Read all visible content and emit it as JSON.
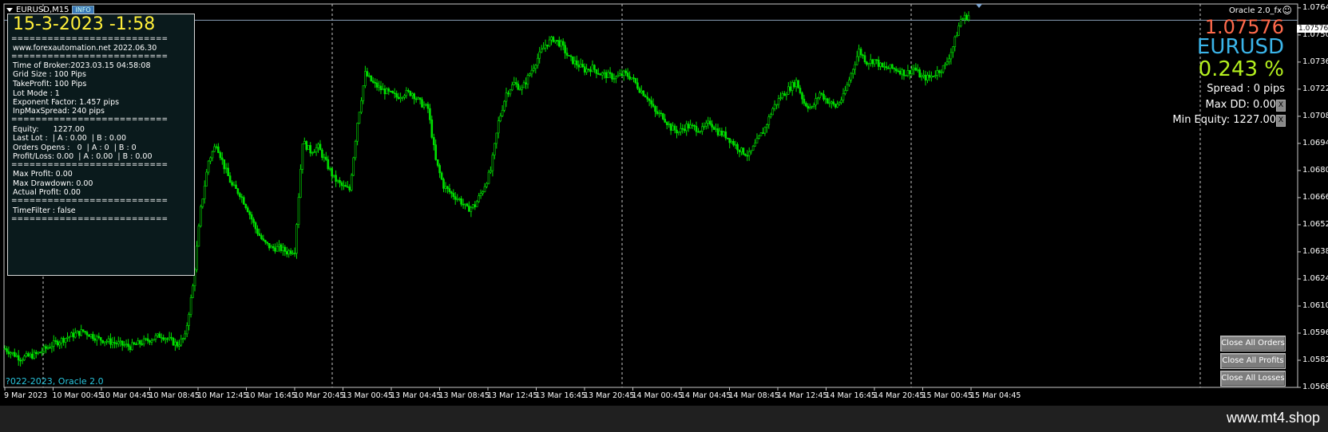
{
  "window": {
    "title": "EURUSD,M15",
    "info_badge": "INFO"
  },
  "ea": {
    "name": "Oracle 2.0_fx",
    "smile": "☺"
  },
  "panel": {
    "clock": "15-3-2023 -1:58",
    "separator": "==========================",
    "website": "www.forexautomation.net 2022.06.30",
    "time_of_broker": "Time of Broker:2023.03.15 04:58:08",
    "grid_size": "Grid Size : 100 Pips",
    "take_profit": "TakeProfit: 100 Pips",
    "lot_mode": "Lot Mode : 1",
    "exponent_factor": "Exponent Factor: 1.457 pips",
    "inp_max_spread": "InpMaxSpread: 240 pips",
    "equity": "Equity:      1227.00",
    "last_lot": "Last Lot :  | A : 0.00  | B : 0.00",
    "orders_opens": "Orders Opens :   0  | A : 0  | B : 0",
    "profit_loss": "Profit/Loss: 0.00  | A : 0.00  | B : 0.00",
    "max_profit": "Max Profit: 0.00",
    "max_drawdown": "Max Drawdown: 0.00",
    "actual_profit": "Actual Profit: 0.00",
    "time_filter": "TimeFilter : false"
  },
  "stats": {
    "price": "1.07576",
    "symbol": "EURUSD",
    "percent": "0.243 %",
    "spread": "Spread : 0 pips",
    "max_dd": "Max DD: 0.00",
    "min_equity": "Min Equity: 1227.00",
    "x_mark": "X"
  },
  "buttons": {
    "close_all_orders": "Close All Orders",
    "close_all_profits": "Close All Profits",
    "close_all_losses": "Close All Losses"
  },
  "copyright": "?022-2023, Oracle 2.0",
  "current_price_tag": "1.07576",
  "footer": {
    "site": "www.mt4.shop"
  },
  "colors": {
    "candle": "#00e000",
    "grid": "#c8c8c8",
    "bid_line": "#8aa0b8"
  },
  "chart_data": {
    "type": "candlestick",
    "symbol": "EURUSD",
    "timeframe": "M15",
    "y_ticks": [
      "1.07640",
      "1.07500",
      "1.07360",
      "1.07220",
      "1.07080",
      "1.06940",
      "1.06800",
      "1.06660",
      "1.06520",
      "1.06380",
      "1.06240",
      "1.06100",
      "1.05960",
      "1.05820",
      "1.05680"
    ],
    "x_ticks": [
      "9 Mar 2023",
      "10 Mar 00:45",
      "10 Mar 04:45",
      "10 Mar 08:45",
      "10 Mar 12:45",
      "10 Mar 16:45",
      "10 Mar 20:45",
      "13 Mar 00:45",
      "13 Mar 04:45",
      "13 Mar 08:45",
      "13 Mar 12:45",
      "13 Mar 16:45",
      "13 Mar 20:45",
      "14 Mar 00:45",
      "14 Mar 04:45",
      "14 Mar 08:45",
      "14 Mar 12:45",
      "14 Mar 16:45",
      "14 Mar 20:45",
      "15 Mar 00:45",
      "15 Mar 04:45"
    ],
    "ylim": [
      1.0568,
      1.0766
    ],
    "current_price": 1.07576,
    "day_separators": [
      "10 Mar",
      "13 Mar",
      "14 Mar",
      "15 Mar"
    ],
    "close_path": [
      [
        0,
        1.0588
      ],
      [
        4,
        1.0583
      ],
      [
        8,
        1.0585
      ],
      [
        12,
        1.059
      ],
      [
        16,
        1.0594
      ],
      [
        20,
        1.0597
      ],
      [
        24,
        1.0593
      ],
      [
        28,
        1.0591
      ],
      [
        32,
        1.0589
      ],
      [
        36,
        1.0592
      ],
      [
        40,
        1.0595
      ],
      [
        44,
        1.059
      ],
      [
        46,
        1.0594
      ],
      [
        48,
        1.062
      ],
      [
        50,
        1.066
      ],
      [
        52,
        1.0685
      ],
      [
        54,
        1.0694
      ],
      [
        56,
        1.0682
      ],
      [
        58,
        1.0672
      ],
      [
        60,
        1.0668
      ],
      [
        62,
        1.066
      ],
      [
        64,
        1.065
      ],
      [
        66,
        1.0643
      ],
      [
        68,
        1.064
      ],
      [
        70,
        1.064
      ],
      [
        72,
        1.0638
      ],
      [
        74,
        1.0639
      ],
      [
        76,
        1.0695
      ],
      [
        78,
        1.069
      ],
      [
        80,
        1.0692
      ],
      [
        82,
        1.0684
      ],
      [
        84,
        1.0676
      ],
      [
        86,
        1.0672
      ],
      [
        88,
        1.067
      ],
      [
        90,
        1.0705
      ],
      [
        92,
        1.073
      ],
      [
        94,
        1.0725
      ],
      [
        96,
        1.0722
      ],
      [
        98,
        1.072
      ],
      [
        100,
        1.0718
      ],
      [
        102,
        1.072
      ],
      [
        104,
        1.072
      ],
      [
        106,
        1.0715
      ],
      [
        108,
        1.0712
      ],
      [
        110,
        1.0685
      ],
      [
        112,
        1.0672
      ],
      [
        114,
        1.0668
      ],
      [
        116,
        1.0665
      ],
      [
        118,
        1.066
      ],
      [
        120,
        1.0662
      ],
      [
        122,
        1.067
      ],
      [
        124,
        1.068
      ],
      [
        126,
        1.0705
      ],
      [
        128,
        1.072
      ],
      [
        130,
        1.0725
      ],
      [
        132,
        1.0722
      ],
      [
        134,
        1.073
      ],
      [
        136,
        1.0738
      ],
      [
        138,
        1.0745
      ],
      [
        140,
        1.0748
      ],
      [
        142,
        1.0745
      ],
      [
        144,
        1.0738
      ],
      [
        146,
        1.0735
      ],
      [
        148,
        1.0732
      ],
      [
        150,
        1.0733
      ],
      [
        152,
        1.073
      ],
      [
        154,
        1.0729
      ],
      [
        156,
        1.0728
      ],
      [
        158,
        1.073
      ],
      [
        160,
        1.0728
      ],
      [
        162,
        1.0722
      ],
      [
        164,
        1.0718
      ],
      [
        166,
        1.071
      ],
      [
        168,
        1.0708
      ],
      [
        170,
        1.0702
      ],
      [
        172,
        1.07
      ],
      [
        174,
        1.0703
      ],
      [
        176,
        1.0702
      ],
      [
        178,
        1.0701
      ],
      [
        180,
        1.0705
      ],
      [
        182,
        1.07
      ],
      [
        184,
        1.0698
      ],
      [
        186,
        1.0694
      ],
      [
        188,
        1.069
      ],
      [
        190,
        1.0688
      ],
      [
        192,
        1.0695
      ],
      [
        194,
        1.0702
      ],
      [
        196,
        1.0712
      ],
      [
        198,
        1.0718
      ],
      [
        200,
        1.0722
      ],
      [
        202,
        1.0726
      ],
      [
        204,
        1.0715
      ],
      [
        206,
        1.0712
      ],
      [
        208,
        1.072
      ],
      [
        210,
        1.0716
      ],
      [
        212,
        1.0713
      ],
      [
        214,
        1.0718
      ],
      [
        216,
        1.073
      ],
      [
        218,
        1.0742
      ],
      [
        220,
        1.0736
      ],
      [
        222,
        1.0737
      ],
      [
        224,
        1.0733
      ],
      [
        226,
        1.0733
      ],
      [
        228,
        1.0732
      ],
      [
        230,
        1.073
      ],
      [
        232,
        1.0733
      ],
      [
        234,
        1.0728
      ],
      [
        236,
        1.0728
      ],
      [
        238,
        1.0731
      ],
      [
        240,
        1.0734
      ],
      [
        242,
        1.0744
      ],
      [
        244,
        1.0758
      ],
      [
        246,
        1.076
      ]
    ]
  }
}
